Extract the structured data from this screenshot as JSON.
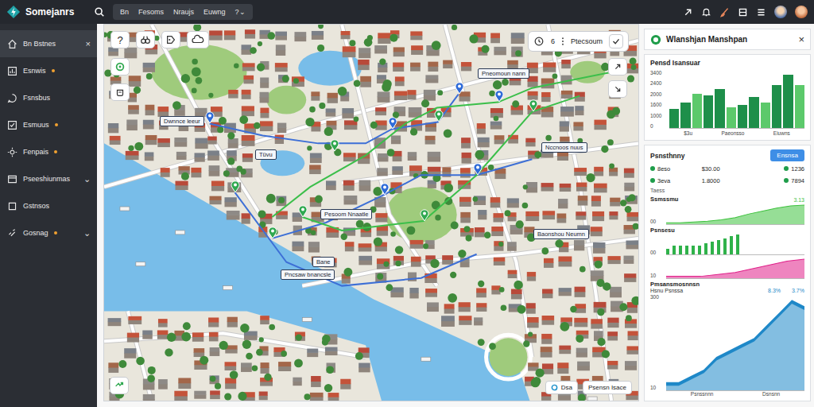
{
  "app": {
    "name": "Somejanrs"
  },
  "top_menu": [
    {
      "label": "Bn",
      "selected": false
    },
    {
      "label": "Fesoms",
      "selected": false
    },
    {
      "label": "Nraujs",
      "selected": false
    },
    {
      "label": "Euwng",
      "selected": false
    },
    {
      "label": "?⌄",
      "selected": false
    }
  ],
  "sidebar": {
    "items": [
      {
        "label": "Bn Bstnes",
        "selected": true,
        "badge": false,
        "trail": "×"
      },
      {
        "label": "Esnwis",
        "selected": false,
        "badge": true
      },
      {
        "label": "Fsnsbus",
        "selected": false,
        "badge": false
      },
      {
        "label": "Esmuus",
        "selected": false,
        "badge": true
      },
      {
        "label": "Fenpais",
        "selected": false,
        "badge": true
      },
      {
        "label": "Pseeshiunmas",
        "selected": false,
        "badge": false,
        "trail": "⌄"
      },
      {
        "label": "Gstnsos",
        "selected": false,
        "badge": false
      },
      {
        "label": "Gosnag",
        "selected": false,
        "badge": true,
        "trail": "⌄"
      }
    ]
  },
  "map": {
    "help_button": "?",
    "counter": "6",
    "view_label": "Ptecsoum",
    "labels": [
      "Pneomoun nann",
      "Dwnnce leeur",
      "Tüvu",
      "Nccnoos nuus",
      "Pesoom Nnaatle",
      "Baonshou Neumn",
      "Bane",
      "Pncsaw bnancsle"
    ],
    "pins": [
      {
        "color": "#2f6bd8"
      },
      {
        "color": "#2f6bd8"
      },
      {
        "color": "#2fa84f"
      },
      {
        "color": "#2f6bd8"
      },
      {
        "color": "#2fa84f"
      },
      {
        "color": "#2fa84f"
      },
      {
        "color": "#2f6bd8"
      },
      {
        "color": "#2f6bd8"
      },
      {
        "color": "#2fa84f"
      },
      {
        "color": "#2fa84f"
      },
      {
        "color": "#2fa84f"
      },
      {
        "color": "#2fa84f"
      },
      {
        "color": "#2f6bd8"
      }
    ],
    "legend": [
      "Dsa",
      "Psensn Isace"
    ]
  },
  "panel": {
    "title": "Wlanshjan Manshpan",
    "close": "×",
    "bar_chart": {
      "title": "Pensd Isansuar",
      "ticks": [
        "3400",
        "2400",
        "2000",
        "1600",
        "1000",
        "0"
      ],
      "values": [
        1100,
        1500,
        2000,
        1900,
        2300,
        1200,
        1350,
        1800,
        1500,
        2500,
        3100,
        2500
      ],
      "x_labels": [
        "$3u",
        "Paeonsso",
        "Eiuwns"
      ]
    },
    "summary": {
      "title": "Psnsthnny",
      "button": "Ensnsa",
      "rows": [
        {
          "label": "8eso",
          "value": "$30.00",
          "count": "1236",
          "color": "#1f9d4a"
        },
        {
          "label": "3eva",
          "value": "1.8000",
          "count": "7894",
          "color": "#1f9d4a"
        }
      ],
      "note": "Taess"
    },
    "trend_charts": [
      {
        "title": "Ssmssmu",
        "annotations": [
          "3.13"
        ],
        "ticks": [
          "00"
        ],
        "kind": "area",
        "color": "#3fc23f",
        "values": [
          2,
          2,
          3,
          4,
          6,
          9,
          14,
          18,
          22,
          25,
          26
        ]
      },
      {
        "title": "Psnsesu",
        "annotations": [],
        "ticks": [
          "00"
        ],
        "kind": "bars",
        "color": "#2fb24a",
        "values": [
          3,
          5,
          5,
          5,
          5,
          5,
          6,
          7,
          8,
          9,
          10,
          11
        ]
      },
      {
        "annotations": [],
        "ticks": [
          "10"
        ],
        "kind": "area",
        "color": "#e0218a",
        "values": [
          1,
          1,
          1,
          2,
          3,
          5,
          7,
          9,
          10
        ]
      },
      {
        "title": "Pmsansmosnnsn",
        "subtitle": "Hsnu Psnssa",
        "annotations": [
          "8.3%",
          "3.7%"
        ],
        "ticks": [
          "300",
          "10"
        ],
        "kind": "area",
        "color": "#1e88c8",
        "values": [
          1,
          1,
          2,
          3,
          5,
          6,
          7,
          8,
          10,
          12,
          14,
          13
        ],
        "x_labels": [
          "Psnssnnn",
          "Dsnsnn"
        ]
      }
    ]
  }
}
